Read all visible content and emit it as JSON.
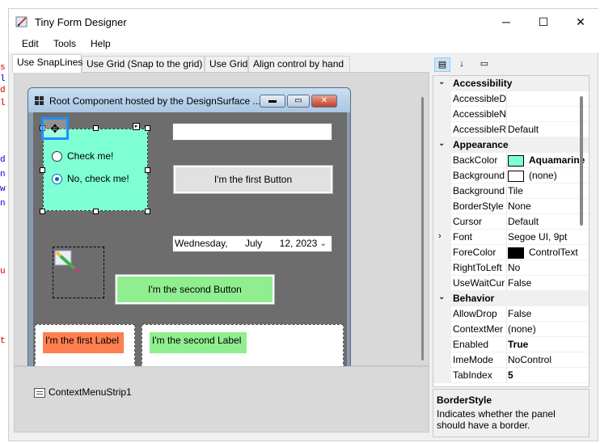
{
  "window": {
    "title": "Tiny Form Designer",
    "minimize": "─",
    "maximize": "☐",
    "close": "✕"
  },
  "code_strip": [
    "s",
    "l",
    "d",
    "l",
    "d",
    "n",
    "w",
    "n",
    "u",
    "t"
  ],
  "menu": [
    "Edit",
    "Tools",
    "Help"
  ],
  "tabs": [
    "Use SnapLines",
    "Use Grid (Snap to the grid)",
    "Use Grid",
    "Align control by hand"
  ],
  "form": {
    "title": "Root Component hosted by the DesignSurface ...",
    "radio1": "Check me!",
    "radio2": "No, check me!",
    "textbox_value": "",
    "button1": "I'm the first Button",
    "date_day": "Wednesday,",
    "date_month": "July",
    "date_rest": "12, 2023",
    "button2": "I'm the second Button",
    "label1": "I'm the first Label",
    "label2": "I'm the second Label"
  },
  "tray": {
    "item": "ContextMenuStrip1"
  },
  "property_grid": {
    "rows": [
      {
        "type": "cat",
        "name": "Accessibility"
      },
      {
        "type": "prop",
        "name": "AccessibleD",
        "value": ""
      },
      {
        "type": "prop",
        "name": "AccessibleN",
        "value": ""
      },
      {
        "type": "prop",
        "name": "AccessibleR",
        "value": "Default"
      },
      {
        "type": "cat",
        "name": "Appearance"
      },
      {
        "type": "prop",
        "name": "BackColor",
        "value": "Aquamarine",
        "swatch": "#7fffd4",
        "bold": true
      },
      {
        "type": "prop",
        "name": "Background",
        "value": "(none)",
        "swatch": "#ffffff"
      },
      {
        "type": "prop",
        "name": "Background",
        "value": "Tile"
      },
      {
        "type": "prop",
        "name": "BorderStyle",
        "value": "None"
      },
      {
        "type": "prop",
        "name": "Cursor",
        "value": "Default"
      },
      {
        "type": "prop",
        "name": "Font",
        "value": "Segoe UI, 9pt",
        "expander": true
      },
      {
        "type": "prop",
        "name": "ForeColor",
        "value": "ControlText",
        "swatch": "#000000"
      },
      {
        "type": "prop",
        "name": "RightToLeft",
        "value": "No"
      },
      {
        "type": "prop",
        "name": "UseWaitCur",
        "value": "False"
      },
      {
        "type": "cat",
        "name": "Behavior"
      },
      {
        "type": "prop",
        "name": "AllowDrop",
        "value": "False"
      },
      {
        "type": "prop",
        "name": "ContextMer",
        "value": "(none)"
      },
      {
        "type": "prop",
        "name": "Enabled",
        "value": "True",
        "bold": true
      },
      {
        "type": "prop",
        "name": "ImeMode",
        "value": "NoControl"
      },
      {
        "type": "prop",
        "name": "TabIndex",
        "value": "5",
        "bold": true
      }
    ],
    "help_title": "BorderStyle",
    "help_text": "Indicates whether the panel should have a border."
  },
  "colors": {
    "panel": "#7fffd4",
    "button2": "#90ee90",
    "label1": "#ff7f50",
    "label2": "#90ee90",
    "selection": "#1e90ff"
  }
}
